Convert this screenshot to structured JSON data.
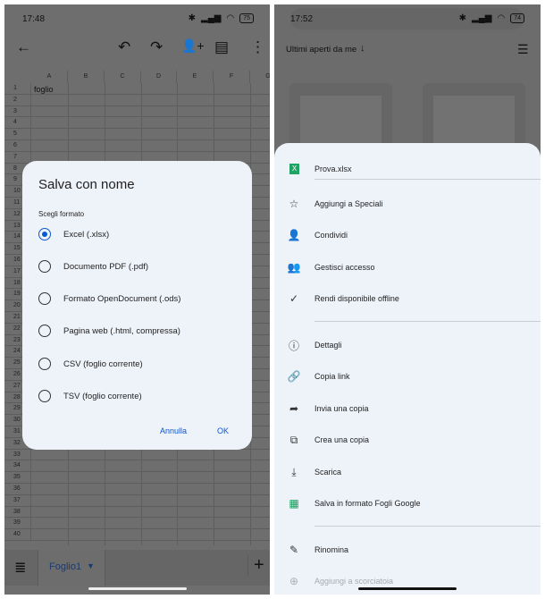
{
  "left": {
    "status": {
      "time": "17:48",
      "battery": "75"
    },
    "toolbar": {
      "icons": [
        "back-arrow-icon",
        "undo-icon",
        "redo-icon",
        "add-person-icon",
        "comment-icon",
        "more-vert-icon"
      ]
    },
    "columns": [
      "A",
      "B",
      "C",
      "D",
      "E",
      "F",
      "G"
    ],
    "cell_a1": "foglio",
    "sheet_tab": "Foglio1",
    "dialog": {
      "title": "Salva con nome",
      "subtitle": "Scegli formato",
      "options": [
        {
          "label": "Excel (.xlsx)",
          "selected": true
        },
        {
          "label": "Documento PDF (.pdf)",
          "selected": false
        },
        {
          "label": "Formato OpenDocument (.ods)",
          "selected": false
        },
        {
          "label": "Pagina web (.html, compressa)",
          "selected": false
        },
        {
          "label": "CSV (foglio corrente)",
          "selected": false
        },
        {
          "label": "TSV (foglio corrente)",
          "selected": false
        }
      ],
      "cancel": "Annulla",
      "ok": "OK"
    }
  },
  "right": {
    "status": {
      "time": "17:52",
      "battery": "74"
    },
    "sort_label": "Ultimi aperti da me",
    "file": {
      "name": "Prova.xlsx",
      "badge": "X"
    },
    "groups": [
      [
        {
          "label": "Aggiungi a Speciali",
          "icon": "star-icon"
        },
        {
          "label": "Condividi",
          "icon": "person-add-icon"
        },
        {
          "label": "Gestisci accesso",
          "icon": "manage-access-icon"
        },
        {
          "label": "Rendi disponibile offline",
          "icon": "offline-icon"
        }
      ],
      [
        {
          "label": "Dettagli",
          "icon": "info-icon"
        },
        {
          "label": "Copia link",
          "icon": "link-icon"
        },
        {
          "label": "Invia una copia",
          "icon": "share-arrow-icon"
        },
        {
          "label": "Crea una copia",
          "icon": "copy-icon"
        },
        {
          "label": "Scarica",
          "icon": "download-icon"
        },
        {
          "label": "Salva in formato Fogli Google",
          "icon": "sheets-icon"
        }
      ],
      [
        {
          "label": "Rinomina",
          "icon": "rename-icon"
        },
        {
          "label": "Aggiungi a scorciatoia",
          "icon": "shortcut-icon"
        }
      ]
    ]
  },
  "colors": {
    "accent": "#0b57d0",
    "sheet_bg": "#eef2f9",
    "xlsx_green": "#21a366",
    "sheets_green": "#0f9d58"
  }
}
